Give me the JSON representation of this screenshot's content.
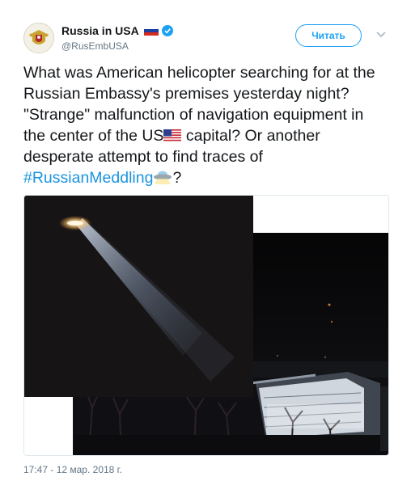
{
  "account": {
    "display_name": "Russia in USA",
    "handle": "@RusEmbUSA",
    "verified": true
  },
  "follow_button": {
    "label": "Читать"
  },
  "tweet": {
    "text_part1": "What was American helicopter searching for at the Russian Embassy's premises yesterday night? \"Strange\" malfunction of navigation equipment in the center of the US",
    "text_part2": " capital? Or another desperate attempt to find traces of ",
    "hashtag": "#RussianMeddling",
    "text_part3": "?",
    "emojis": [
      "us-flag",
      "ufo"
    ]
  },
  "media": {
    "description_icons": [
      "helicopter-searchlight-photo",
      "embassy-building-photo"
    ]
  },
  "timestamp": "17:47 - 12 мар. 2018 г.",
  "colors": {
    "link": "#1b95e0",
    "follow": "#1da1f2",
    "muted": "#657786",
    "text": "#14171a"
  }
}
